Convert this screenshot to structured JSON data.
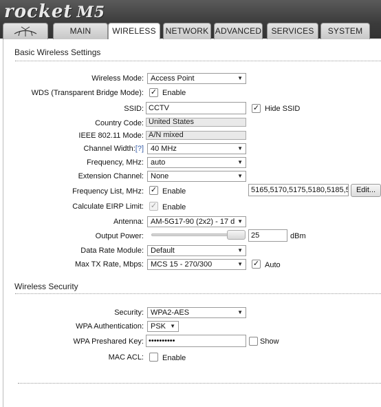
{
  "header": {
    "logo": "rocket",
    "model": "M5"
  },
  "tabs": [
    {
      "label": ""
    },
    {
      "label": "MAIN"
    },
    {
      "label": "WIRELESS"
    },
    {
      "label": "NETWORK"
    },
    {
      "label": "ADVANCED"
    },
    {
      "label": "SERVICES"
    },
    {
      "label": "SYSTEM"
    }
  ],
  "basic": {
    "title": "Basic Wireless Settings",
    "wireless_mode_label": "Wireless Mode:",
    "wireless_mode_value": "Access Point",
    "wds_label": "WDS (Transparent Bridge Mode):",
    "wds_option": "Enable",
    "ssid_label": "SSID:",
    "ssid_value": "CCTV",
    "hide_ssid_label": "Hide SSID",
    "country_label": "Country Code:",
    "country_value": "United States",
    "ieee_label": "IEEE 802.11 Mode:",
    "ieee_value": "A/N mixed",
    "channel_width_label": "Channel Width:",
    "channel_width_help": "[?]",
    "channel_width_value": "40 MHz",
    "frequency_label": "Frequency, MHz:",
    "frequency_value": "auto",
    "extension_channel_label": "Extension Channel:",
    "extension_channel_value": "None",
    "freq_list_label": "Frequency List, MHz:",
    "freq_list_option": "Enable",
    "freq_list_value": "5165,5170,5175,5180,5185,5",
    "edit_button": "Edit...",
    "eirp_label": "Calculate EIRP Limit:",
    "eirp_option": "Enable",
    "antenna_label": "Antenna:",
    "antenna_value": "AM-5G17-90 (2x2) - 17 d",
    "output_power_label": "Output Power:",
    "output_power_value": "25",
    "output_power_unit": "dBm",
    "data_rate_label": "Data Rate Module:",
    "data_rate_value": "Default",
    "max_tx_label": "Max TX Rate, Mbps:",
    "max_tx_value": "MCS 15 - 270/300",
    "max_tx_auto": "Auto"
  },
  "security": {
    "title": "Wireless Security",
    "security_label": "Security:",
    "security_value": "WPA2-AES",
    "wpa_auth_label": "WPA Authentication:",
    "wpa_auth_value": "PSK",
    "psk_label": "WPA Preshared Key:",
    "psk_value": "••••••••••",
    "show_label": "Show",
    "mac_acl_label": "MAC ACL:",
    "mac_acl_option": "Enable"
  }
}
